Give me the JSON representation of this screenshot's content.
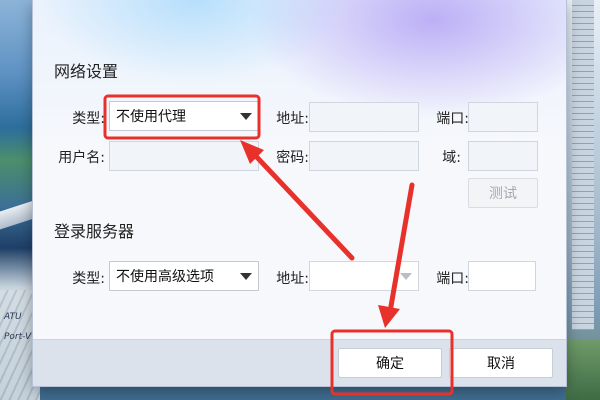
{
  "network": {
    "title": "网络设置",
    "type_label": "类型:",
    "type_value": "不使用代理",
    "address_label": "地址:",
    "address_value": "",
    "port_label": "端口:",
    "port_value": "",
    "username_label": "用户名:",
    "username_value": "",
    "password_label": "密码:",
    "password_value": "",
    "domain_label": "域:",
    "domain_value": "",
    "test_button": "测试"
  },
  "login_server": {
    "title": "登录服务器",
    "type_label": "类型:",
    "type_value": "不使用高级选项",
    "address_label": "地址:",
    "address_value": "",
    "port_label": "端口:",
    "port_value": ""
  },
  "footer": {
    "ok_button": "确定",
    "cancel_button": "取消"
  },
  "wallpaper": {
    "map_text_1": "ATU",
    "map_text_2": "Port-V"
  },
  "colors": {
    "annotation_red": "#e8312b",
    "dialog_bg": "#f7f8fb",
    "footer_bg": "#dbe2ec"
  }
}
